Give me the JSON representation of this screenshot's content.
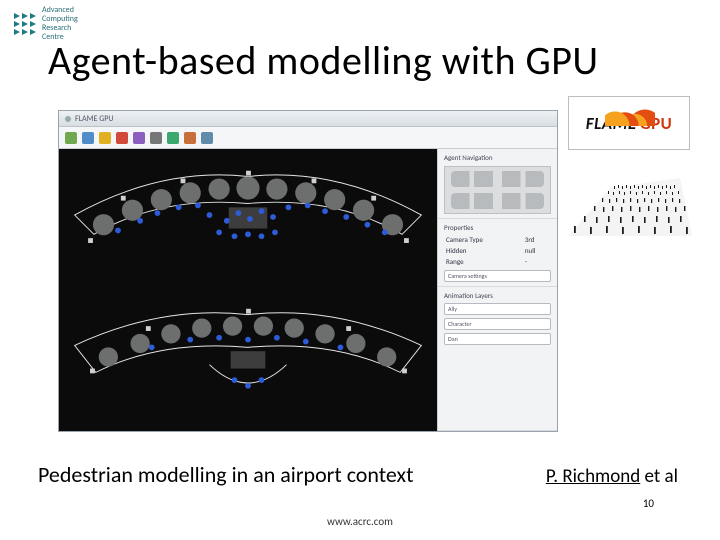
{
  "org": {
    "line1": "Advanced",
    "line2": "Computing",
    "line3": "Research",
    "line4": "Centre"
  },
  "title": "Agent-based modelling with GPU",
  "flame_logo": {
    "word1": "FLAME",
    "word2": "GPU"
  },
  "app": {
    "window_title": "FLAME GPU",
    "sidepanel": {
      "section_nav_label": "Agent Navigation",
      "section_props_label": "Properties",
      "props": [
        [
          "Camera Type",
          "3rd"
        ],
        [
          "Hidden",
          "null"
        ],
        [
          "Range",
          "-"
        ]
      ],
      "btn_camera": "Camera settings",
      "section_anim_label": "Animation Layers",
      "layer_buttons": [
        "Ally",
        "Character",
        "Dan"
      ]
    }
  },
  "caption": "Pedestrian modelling in an airport context",
  "attribution": {
    "name": "P. Richmond",
    "suffix": " et al"
  },
  "page_number": "10",
  "footer_url": "www.acrc.com"
}
